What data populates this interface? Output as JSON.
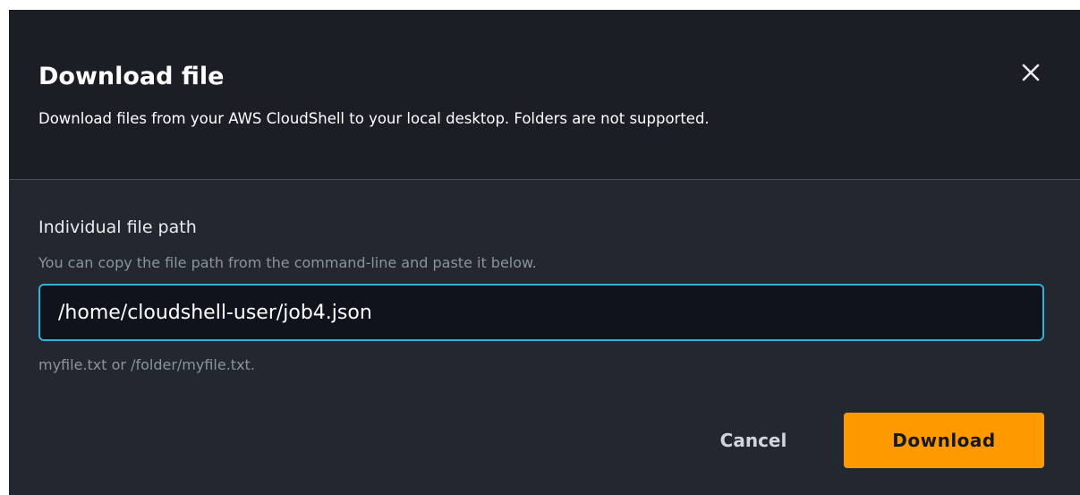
{
  "dialog": {
    "title": "Download file",
    "description": "Download files from your AWS CloudShell to your local desktop. Folders are not supported.",
    "close_icon": "close-icon"
  },
  "form": {
    "label": "Individual file path",
    "hint": "You can copy the file path from the command-line and paste it below.",
    "path_value": "/home/cloudshell-user/job4.json",
    "constraint": "myfile.txt or /folder/myfile.txt."
  },
  "footer": {
    "cancel_label": "Cancel",
    "download_label": "Download"
  },
  "colors": {
    "header_bg": "#1b1e25",
    "body_bg": "#232730",
    "input_focus_border": "#2fb4d8",
    "primary_button": "#ff9900"
  }
}
